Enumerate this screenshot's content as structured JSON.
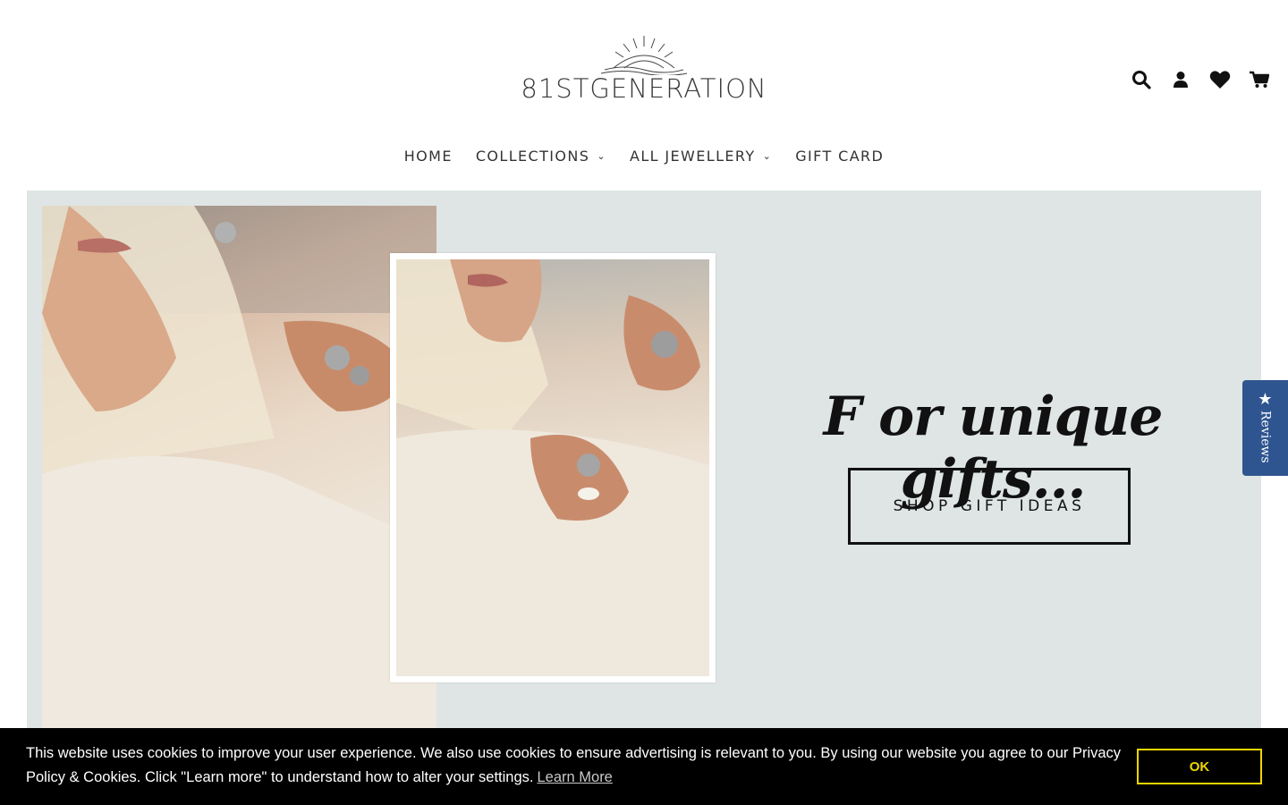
{
  "header": {
    "logo_text": "81STGENERATION",
    "icons": [
      "search-icon",
      "user-icon",
      "heart-icon",
      "cart-icon"
    ]
  },
  "nav": {
    "items": [
      {
        "label": "HOME",
        "has_dropdown": false
      },
      {
        "label": "COLLECTIONS",
        "has_dropdown": true
      },
      {
        "label": "ALL JEWELLERY",
        "has_dropdown": true
      },
      {
        "label": "GIFT CARD",
        "has_dropdown": false
      }
    ],
    "dropdown_glyph": "⌄"
  },
  "hero": {
    "tagline": "F or unique gifts...",
    "cta_label": "SHOP GIFT IDEAS",
    "background_color": "#dfe5e5"
  },
  "reviews_tab": {
    "label": "Reviews",
    "star": "★",
    "color": "#2f5591"
  },
  "cookie_banner": {
    "text": "This website uses cookies to improve your user experience. We also use cookies to ensure advertising is relevant to you. By using our website you agree to our Privacy Policy & Cookies. Click \"Learn more\" to understand how to alter your settings.",
    "learn_more": "Learn More",
    "ok_label": "OK",
    "accent_color": "#f1d600"
  }
}
